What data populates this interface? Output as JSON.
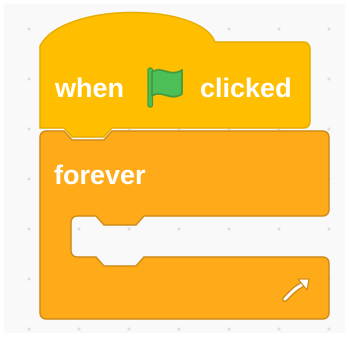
{
  "workspace": {
    "background": "#f9f9f9",
    "grid_dot_color": "#dcdcdc"
  },
  "hat_block": {
    "label_before": "when",
    "label_after": "clicked",
    "icon": "green-flag-icon",
    "fill": "#ffbf00",
    "stroke": "#e6ac00"
  },
  "forever_block": {
    "label": "forever",
    "icon": "loop-arrow-icon",
    "fill": "#ffab19",
    "stroke": "#cf8b17"
  },
  "flag_colors": {
    "fill": "#4cbf56",
    "stroke": "#45993d"
  }
}
